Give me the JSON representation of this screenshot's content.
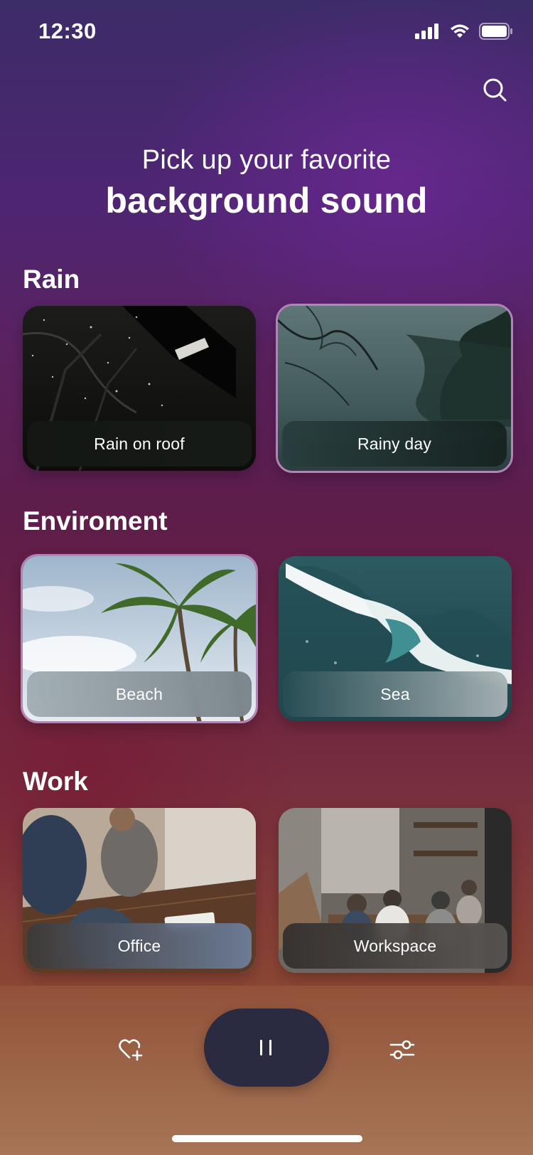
{
  "status": {
    "time": "12:30"
  },
  "heading": {
    "line1": "Pick up your favorite",
    "line2": "background sound"
  },
  "sections": [
    {
      "title": "Rain",
      "cards": [
        {
          "label": "Rain on roof",
          "selected": false
        },
        {
          "label": "Rainy day",
          "selected": true
        }
      ]
    },
    {
      "title": "Enviroment",
      "cards": [
        {
          "label": "Beach",
          "selected": true
        },
        {
          "label": "Sea",
          "selected": false
        }
      ]
    },
    {
      "title": "Work",
      "cards": [
        {
          "label": "Office",
          "selected": false
        },
        {
          "label": "Workspace",
          "selected": false
        }
      ]
    }
  ],
  "icons": {
    "search": "search-icon",
    "favorite": "heart-plus-icon",
    "playback": "pause-icon",
    "settings": "sliders-icon"
  },
  "colors": {
    "play_button": "#2a2a40",
    "selected_border": "#be96c8"
  }
}
